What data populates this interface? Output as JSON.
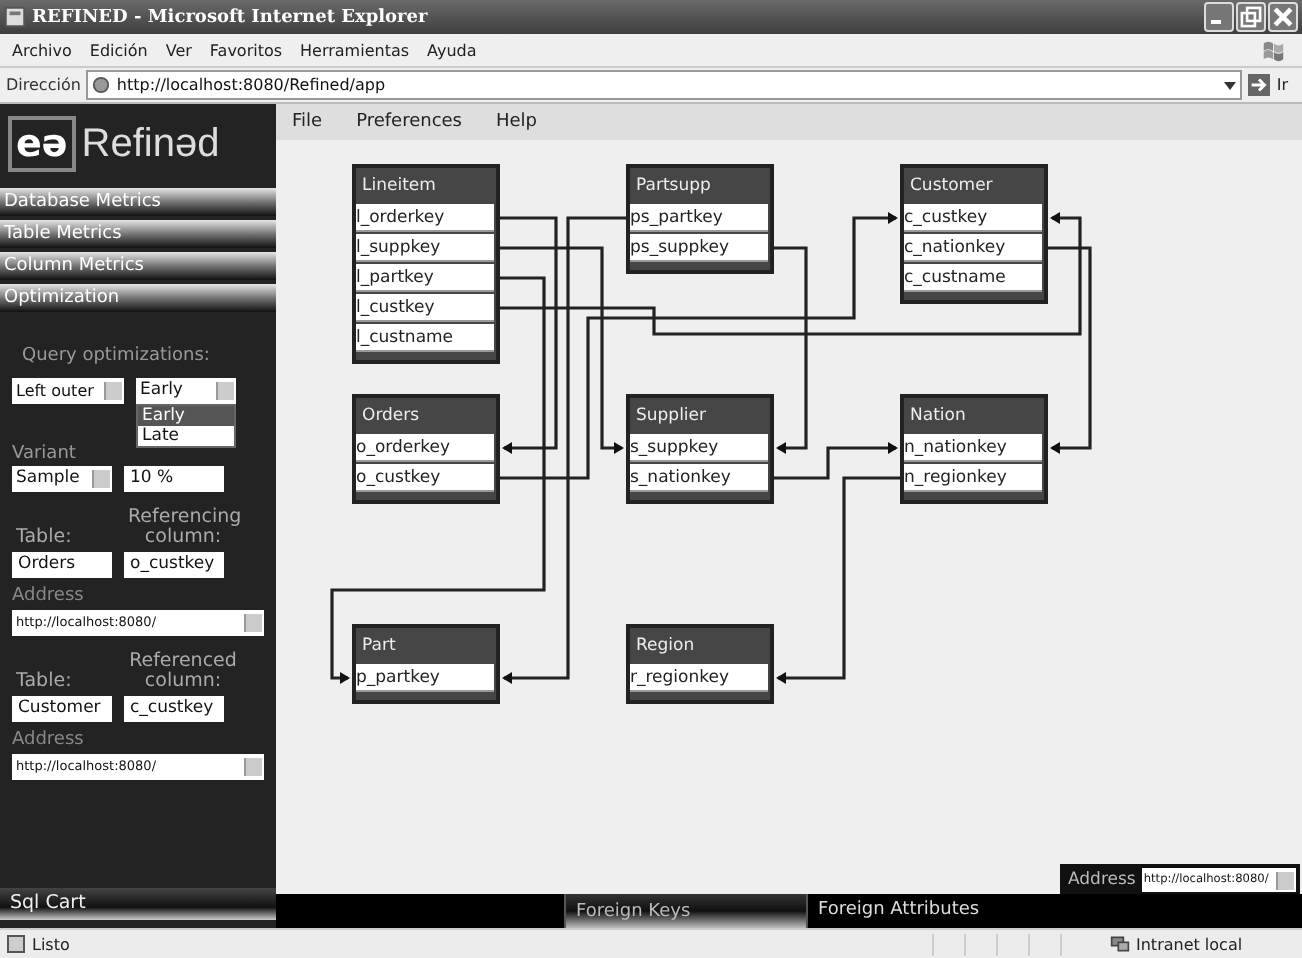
{
  "window": {
    "title": "REFINED - Microsoft Internet Explorer"
  },
  "browser_menu": [
    "Archivo",
    "Edición",
    "Ver",
    "Favoritos",
    "Herramientas",
    "Ayuda"
  ],
  "address_bar": {
    "label": "Dirección",
    "url": "http://localhost:8080/Refined/app",
    "go": "Ir"
  },
  "logo": {
    "mark": "eə",
    "text": "Refinəd"
  },
  "sidebar": {
    "sections": [
      "Database Metrics",
      "Table Metrics",
      "Column Metrics",
      "Optimization"
    ],
    "optimization": {
      "label": "Query optimizations:",
      "join": "Left outer",
      "timing": "Early",
      "timing_options": [
        {
          "label": "Early",
          "selected": true
        },
        {
          "label": "Late",
          "selected": false
        }
      ],
      "variant_label": "Variant",
      "variant": "Sample",
      "amount": "10 %",
      "keys": [
        {
          "table_label": "Table:",
          "column_label": "Referencing column:",
          "table": "Orders",
          "column": "o_custkey",
          "address_label": "Address",
          "address": "http://localhost:8080/"
        },
        {
          "table_label": "Table:",
          "column_label": "Referenced column:",
          "table": "Customer",
          "column": "c_custkey",
          "address_label": "Address",
          "address": "http://localhost:8080/"
        }
      ]
    },
    "cart": "Sql Cart"
  },
  "app_menu": [
    "File",
    "Preferences",
    "Help"
  ],
  "tables": [
    {
      "name": "Lineitem",
      "columns": [
        "l_orderkey",
        "l_suppkey",
        "l_partkey",
        "l_custkey",
        "l_custname"
      ]
    },
    {
      "name": "Partsupp",
      "columns": [
        "ps_partkey",
        "ps_suppkey"
      ]
    },
    {
      "name": "Customer",
      "columns": [
        "c_custkey",
        "c_nationkey",
        "c_custname"
      ]
    },
    {
      "name": "Orders",
      "columns": [
        "o_orderkey",
        "o_custkey"
      ]
    },
    {
      "name": "Supplier",
      "columns": [
        "s_suppkey",
        "s_nationkey"
      ]
    },
    {
      "name": "Nation",
      "columns": [
        "n_nationkey",
        "n_regionkey"
      ]
    },
    {
      "name": "Part",
      "columns": [
        "p_partkey"
      ]
    },
    {
      "name": "Region",
      "columns": [
        "r_regionkey"
      ]
    }
  ],
  "address_panel": {
    "label": "Address",
    "value": "http://localhost:8080/"
  },
  "bottom_tabs": [
    {
      "label": "Foreign Keys",
      "selected": true
    },
    {
      "label": "Foreign Attributes",
      "selected": false
    }
  ],
  "status_bar": {
    "text": "Listo",
    "zone": "Intranet local"
  }
}
